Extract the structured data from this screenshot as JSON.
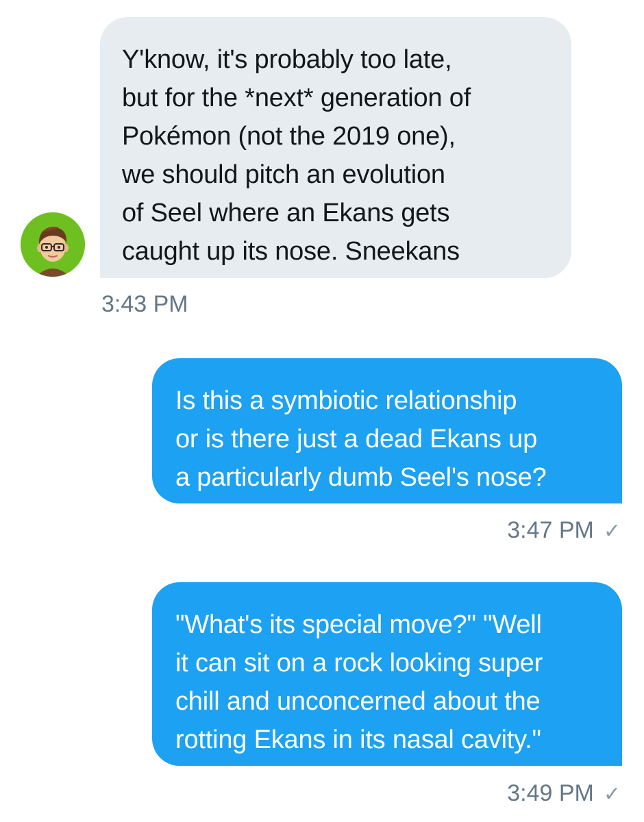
{
  "conversation": {
    "messages": [
      {
        "direction": "incoming",
        "lines": [
          "Y'know, it's probably too late,",
          "but for the *next* generation of",
          "Pokémon (not the 2019 one),",
          "we should pitch an evolution",
          "of Seel where an Ekans gets",
          "caught up its nose. Sneekans"
        ],
        "time": "3:43 PM"
      },
      {
        "direction": "outgoing",
        "lines": [
          "Is this a symbiotic relationship",
          "or is there just a dead Ekans up",
          "a particularly dumb Seel's nose?"
        ],
        "time": "3:47 PM",
        "status_icon": "check-icon"
      },
      {
        "direction": "outgoing",
        "lines": [
          "\"What's its special move?\" \"Well",
          "it can sit on a rock looking super",
          "chill and unconcerned about the",
          "rotting Ekans in its nasal cavity.\""
        ],
        "time": "3:49 PM",
        "status_icon": "check-icon"
      }
    ]
  },
  "colors": {
    "incoming_bubble": "#e6ecf0",
    "outgoing_bubble": "#1da1f2",
    "avatar_background": "#6dc01f",
    "timestamp": "#657786"
  },
  "icons": {
    "check": "✓"
  }
}
